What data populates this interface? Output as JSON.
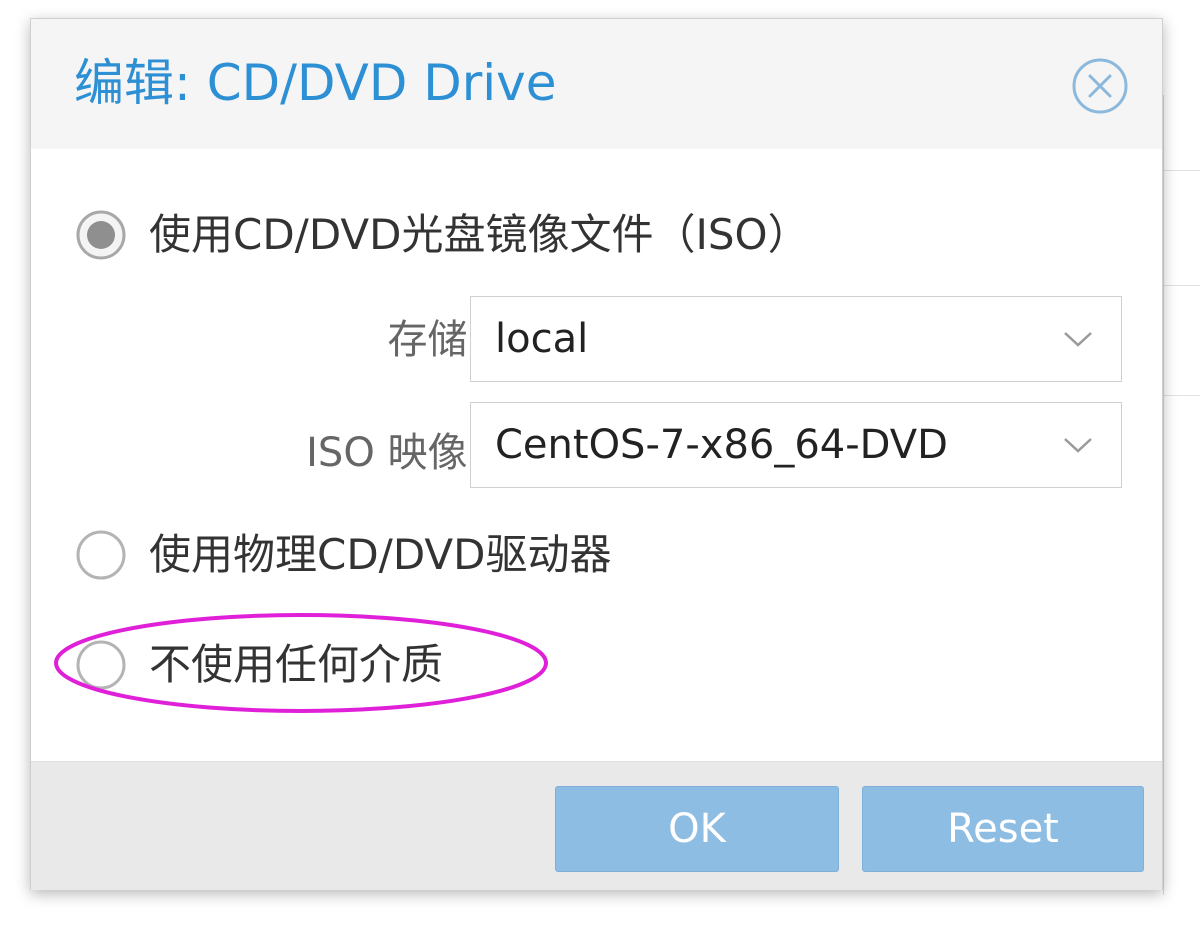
{
  "dialog": {
    "title": "编辑: CD/DVD Drive",
    "close_icon": "close-circle-icon"
  },
  "options": [
    {
      "label": "使用CD/DVD光盘镜像文件（ISO）",
      "selected": true
    },
    {
      "label": "使用物理CD/DVD驱动器",
      "selected": false
    },
    {
      "label": "不使用任何介质",
      "selected": false
    }
  ],
  "fields": {
    "storage": {
      "label": "存储:",
      "value": "local"
    },
    "iso": {
      "label": "ISO 映像:",
      "value": "CentOS-7-x86_64-DVD"
    }
  },
  "buttons": {
    "ok": "OK",
    "reset": "Reset"
  },
  "colors": {
    "title": "#2d8fd4",
    "button": "#8ebde3",
    "annotation": "#e020d8"
  }
}
